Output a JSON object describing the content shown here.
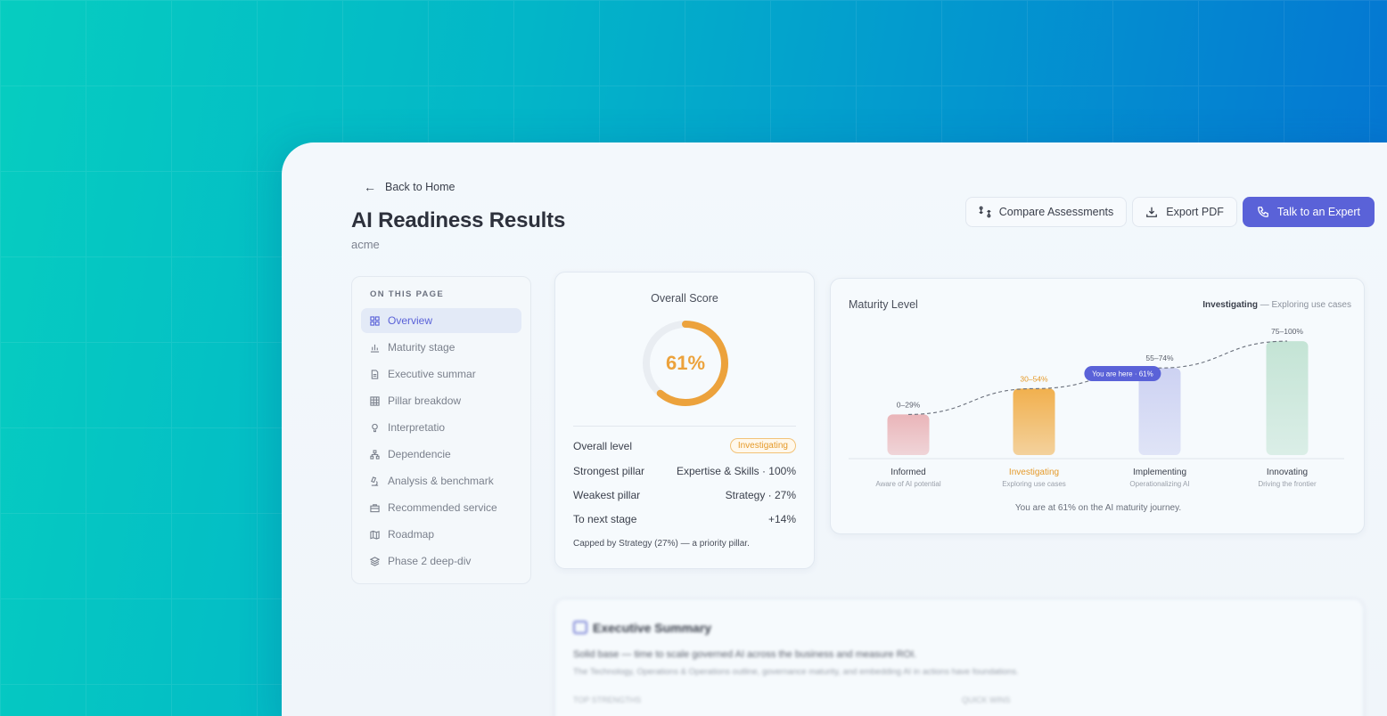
{
  "header": {
    "back_label": "Back to Home",
    "title": "AI Readiness Results",
    "org": "acme"
  },
  "actions": {
    "compare_label": "Compare Assessments",
    "export_label": "Export PDF",
    "expert_label": "Talk to an Expert"
  },
  "toc": {
    "heading": "ON THIS PAGE",
    "items": [
      {
        "label": "Overview",
        "icon": "grid-icon"
      },
      {
        "label": "Maturity stage",
        "icon": "bar-chart-icon"
      },
      {
        "label": "Executive summar",
        "icon": "document-icon"
      },
      {
        "label": "Pillar breakdow",
        "icon": "table-icon"
      },
      {
        "label": "Interpretatio",
        "icon": "lightbulb-icon"
      },
      {
        "label": "Dependencie",
        "icon": "hierarchy-icon"
      },
      {
        "label": "Analysis & benchmark",
        "icon": "microscope-icon"
      },
      {
        "label": "Recommended service",
        "icon": "briefcase-icon"
      },
      {
        "label": "Roadmap",
        "icon": "map-icon"
      },
      {
        "label": "Phase 2 deep-div",
        "icon": "layers-icon"
      }
    ]
  },
  "score": {
    "label": "Overall Score",
    "value": 0.61,
    "value_text": "61%",
    "rows": [
      {
        "label": "Overall level",
        "value": "Investigating"
      },
      {
        "label": "Strongest pillar",
        "value": "Expertise & Skills · 100%"
      },
      {
        "label": "Weakest pillar",
        "value": "Strategy · 27%"
      },
      {
        "label": "To next stage",
        "value": "+14%"
      }
    ],
    "note": "Capped by Strategy (27%) — a priority pillar.",
    "color": "#eca23c"
  },
  "maturity": {
    "title": "Maturity Level",
    "current_stage": "Investigating",
    "current_desc": "— Exploring use cases",
    "footer": "You are at 61% on the AI maturity journey.",
    "marker_label": "You are here · 61%"
  },
  "chart_data": {
    "type": "bar",
    "categories": [
      "Informed",
      "Investigating",
      "Implementing",
      "Innovating"
    ],
    "subtitles": [
      "Aware of AI potential",
      "Exploring use cases",
      "Operationalizing AI",
      "Driving the frontier"
    ],
    "range_labels": [
      "0–29%",
      "30–54%",
      "55–74%",
      "75–100%"
    ],
    "values": [
      29,
      54,
      74,
      100
    ],
    "colors": [
      "#eab5b9",
      "#f1b04e",
      "#cdd2f2",
      "#c4e4d5"
    ],
    "highlight_index": 1,
    "marker": {
      "value": 61,
      "label": "You are here · 61%"
    },
    "ylim": [
      0,
      100
    ]
  },
  "exec": {
    "title": "Executive Summary",
    "line1": "Solid base — time to scale governed AI across the business and measure ROI.",
    "line2": "The Technology, Operations & Operations outline, governance maturity, and embedding AI in actions have foundations.",
    "meta1": "TOP STRENGTHS",
    "meta2": "QUICK WINS"
  }
}
